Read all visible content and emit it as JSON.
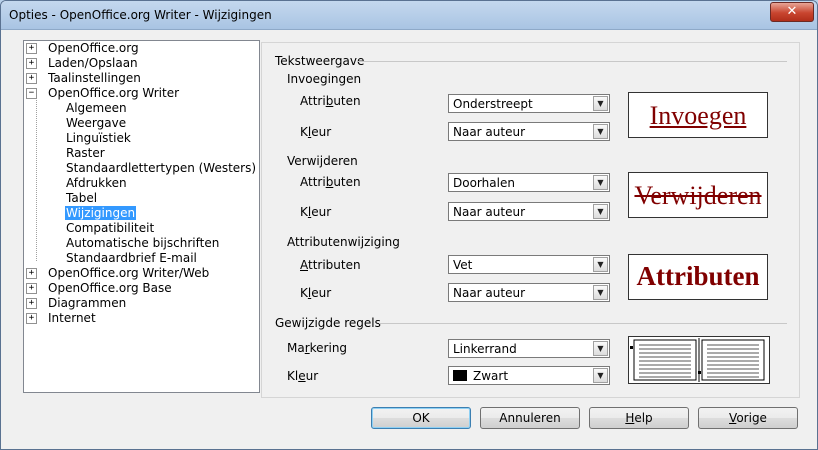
{
  "window": {
    "title": "Opties - OpenOffice.org Writer - Wijzigingen",
    "close_glyph": "✕"
  },
  "tree": {
    "items": [
      {
        "label": "OpenOffice.org",
        "expander": "+"
      },
      {
        "label": "Laden/Opslaan",
        "expander": "+"
      },
      {
        "label": "Taalinstellingen",
        "expander": "+"
      },
      {
        "label": "OpenOffice.org Writer",
        "expander": "−"
      },
      {
        "label": "Algemeen"
      },
      {
        "label": "Weergave"
      },
      {
        "label": "Linguïstiek"
      },
      {
        "label": "Raster"
      },
      {
        "label": "Standaardlettertypen (Westers)"
      },
      {
        "label": "Afdrukken"
      },
      {
        "label": "Tabel"
      },
      {
        "label": "Wijzigingen"
      },
      {
        "label": "Compatibiliteit"
      },
      {
        "label": "Automatische bijschriften"
      },
      {
        "label": "Standaardbrief E-mail"
      },
      {
        "label": "OpenOffice.org Writer/Web",
        "expander": "+"
      },
      {
        "label": "OpenOffice.org Base",
        "expander": "+"
      },
      {
        "label": "Diagrammen",
        "expander": "+"
      },
      {
        "label": "Internet",
        "expander": "+"
      }
    ],
    "selected": "Wijzigingen"
  },
  "text_display": {
    "heading": "Tekstweergave",
    "insertions": {
      "heading": "Invoegingen",
      "attributes_label": [
        "Attri",
        "b",
        "uten"
      ],
      "attributes_value": "Onderstreept",
      "color_label": [
        "K",
        "l",
        "eur"
      ],
      "color_value": "Naar auteur",
      "preview": "Invoegen"
    },
    "deletions": {
      "heading": "Verwijderen",
      "attributes_label": [
        "Attri",
        "b",
        "uten"
      ],
      "attributes_value": "Doorhalen",
      "color_label": [
        "K",
        "l",
        "eur"
      ],
      "color_value": "Naar auteur",
      "preview": "Verwijderen"
    },
    "attribute_changes": {
      "heading": "Attributenwijziging",
      "attributes_label": [
        "",
        "A",
        "ttributen"
      ],
      "attributes_value": "Vet",
      "color_label": [
        "K",
        "l",
        "eur"
      ],
      "color_value": "Naar auteur",
      "preview": "Attributen"
    }
  },
  "changed_lines": {
    "heading": "Gewijzigde regels",
    "marking_label": [
      "Ma",
      "r",
      "kering"
    ],
    "marking_value": "Linkerrand",
    "color_label": [
      "Kl",
      "e",
      "ur"
    ],
    "color_value": "Zwart",
    "color_swatch": "#000000"
  },
  "buttons": {
    "ok": "OK",
    "cancel": "Annuleren",
    "help": [
      "",
      "H",
      "elp"
    ],
    "back": [
      "",
      "V",
      "orige"
    ]
  },
  "colors": {
    "preview_text": "#800000",
    "selection": "#3399ff"
  }
}
